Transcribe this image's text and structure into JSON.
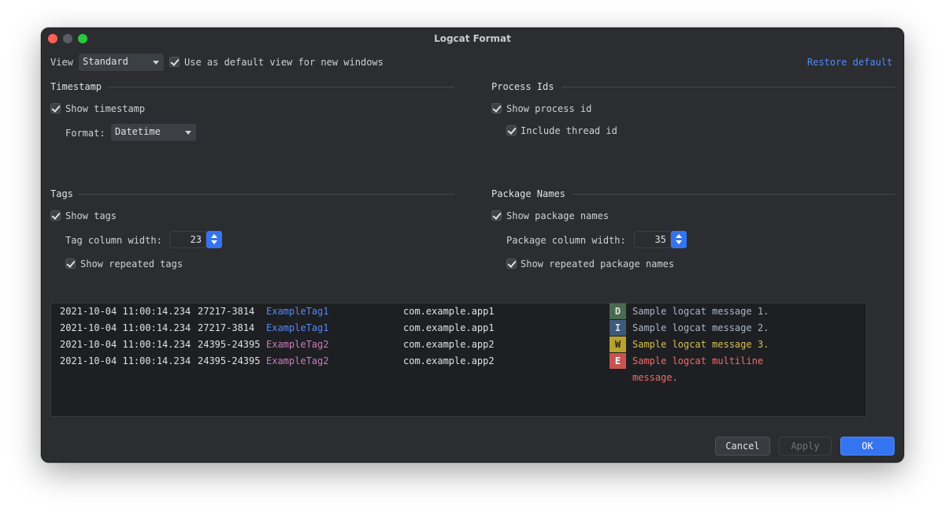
{
  "window": {
    "title": "Logcat Format"
  },
  "toolbar": {
    "view_label": "View",
    "view_value": "Standard",
    "default_label": "Use as default view for new windows",
    "restore_label": "Restore default"
  },
  "timestamp": {
    "title": "Timestamp",
    "show_label": "Show timestamp",
    "format_label": "Format:",
    "format_value": "Datetime"
  },
  "process": {
    "title": "Process Ids",
    "show_label": "Show process id",
    "thread_label": "Include thread id"
  },
  "tags": {
    "title": "Tags",
    "show_label": "Show tags",
    "width_label": "Tag column width:",
    "width_value": "23",
    "repeated_label": "Show repeated tags"
  },
  "packages": {
    "title": "Package Names",
    "show_label": "Show package names",
    "width_label": "Package column width:",
    "width_value": "35",
    "repeated_label": "Show repeated package names"
  },
  "preview": {
    "rows": [
      {
        "timestamp": "2021-10-04 11:00:14.234",
        "pid": "27217-3814",
        "tag": "ExampleTag1",
        "package": "com.example.app1",
        "level": "D",
        "message": "Sample logcat message 1."
      },
      {
        "timestamp": "2021-10-04 11:00:14.234",
        "pid": "27217-3814",
        "tag": "ExampleTag1",
        "package": "com.example.app1",
        "level": "I",
        "message": "Sample logcat message 2."
      },
      {
        "timestamp": "2021-10-04 11:00:14.234",
        "pid": "24395-24395",
        "tag": "ExampleTag2",
        "package": "com.example.app2",
        "level": "W",
        "message": "Sample logcat message 3."
      },
      {
        "timestamp": "2021-10-04 11:00:14.234",
        "pid": "24395-24395",
        "tag": "ExampleTag2",
        "package": "com.example.app2",
        "level": "E",
        "message": "Sample logcat multiline",
        "message_cont": "message."
      }
    ]
  },
  "buttons": {
    "cancel": "Cancel",
    "apply": "Apply",
    "ok": "OK"
  },
  "colors": {
    "tag1": "#548af7",
    "tag2": "#c77dbb",
    "level_d_bg": "#4a6a4f",
    "level_i_bg": "#3c5a7a",
    "level_w_bg": "#b8a22e",
    "level_e_bg": "#c75450"
  }
}
